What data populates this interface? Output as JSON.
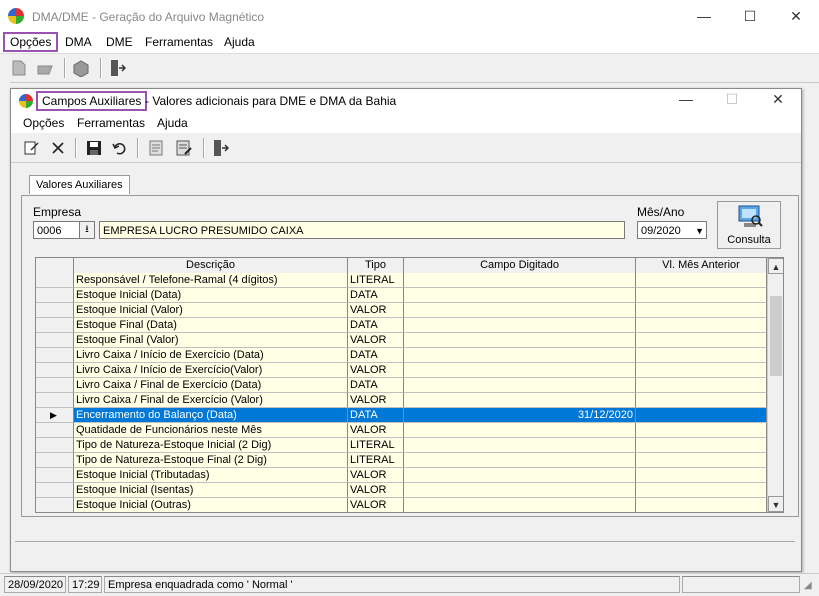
{
  "app": {
    "title": "DMA/DME - Geração do Arquivo Magnético",
    "menu": [
      "Opções",
      "DMA",
      "DME",
      "Ferramentas",
      "Ajuda"
    ],
    "minimize": "—",
    "maximize": "☐",
    "close": "✕"
  },
  "dialog": {
    "title_highlight": "Campos Auxiliares",
    "title_rest": " - Valores adicionais para DME e DMA da Bahia",
    "minimize": "—",
    "maximize": "☐",
    "close": "✕",
    "menu": [
      "Opções",
      "Ferramentas",
      "Ajuda"
    ],
    "tab": "Valores Auxiliares",
    "empresa_label": "Empresa",
    "empresa_code": "0006",
    "empresa_name": "EMPRESA LUCRO PRESUMIDO CAIXA",
    "mes_ano_label": "Mês/Ano",
    "mes_ano_value": "09/2020",
    "consulta_label": "Consulta"
  },
  "grid": {
    "columns": [
      "Descrição",
      "Tipo",
      "Campo Digitado",
      "Vl. Mês Anterior"
    ],
    "selected_index": 9,
    "rows": [
      [
        "Responsável / Telefone-Ramal (4 dígitos)",
        "LITERAL",
        "",
        ""
      ],
      [
        "Estoque Inicial (Data)",
        "DATA",
        "",
        ""
      ],
      [
        "Estoque Inicial (Valor)",
        "VALOR",
        "",
        ""
      ],
      [
        "Estoque Final (Data)",
        "DATA",
        "",
        ""
      ],
      [
        "Estoque Final (Valor)",
        "VALOR",
        "",
        ""
      ],
      [
        "Livro Caixa / Início de Exercício (Data)",
        "DATA",
        "",
        ""
      ],
      [
        "Livro Caixa / Início de Exercício(Valor)",
        "VALOR",
        "",
        ""
      ],
      [
        "Livro Caixa / Final de Exercício (Data)",
        "DATA",
        "",
        ""
      ],
      [
        "Livro Caixa / Final de Exercício (Valor)",
        "VALOR",
        "",
        ""
      ],
      [
        "Encerramento do Balanço (Data)",
        "DATA",
        "31/12/2020",
        ""
      ],
      [
        "Quatidade de Funcionários neste Mês",
        "VALOR",
        "",
        ""
      ],
      [
        "Tipo de Natureza-Estoque Inicial (2 Dig)",
        "LITERAL",
        "",
        ""
      ],
      [
        "Tipo de Natureza-Estoque Final (2 Dig)",
        "LITERAL",
        "",
        ""
      ],
      [
        "Estoque Inicial (Tributadas)",
        "VALOR",
        "",
        ""
      ],
      [
        "Estoque Inicial (Isentas)",
        "VALOR",
        "",
        ""
      ],
      [
        "Estoque Inicial (Outras)",
        "VALOR",
        "",
        ""
      ]
    ]
  },
  "status": {
    "date": "28/09/2020",
    "time": "17:29",
    "message": "Empresa enquadrada como ' Normal '"
  },
  "colors": {
    "highlight": "#9b52b0",
    "selection": "#0078d7",
    "field_bg": "#ffffe6"
  }
}
